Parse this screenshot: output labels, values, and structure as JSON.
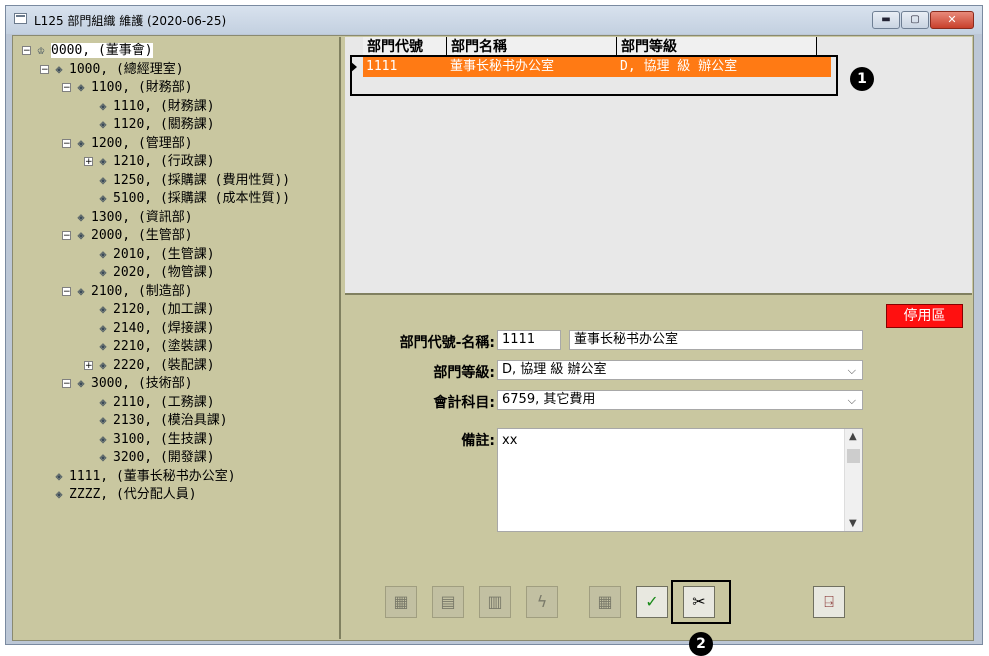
{
  "window": {
    "title": "L125 部門組織 維護 (2020-06-25)",
    "controls": {
      "minimize": "▬",
      "maximize": "▢",
      "close": "✕"
    }
  },
  "tree": {
    "nodes": [
      {
        "label": "0000, (董事會)",
        "level": 0,
        "expander": "−",
        "icon": "org-root-icon",
        "selected": true
      },
      {
        "label": "1000, (總經理室)",
        "level": 1,
        "expander": "−"
      },
      {
        "label": "1100, (財務部)",
        "level": 2,
        "expander": "−"
      },
      {
        "label": "1110, (財務課)",
        "level": 3,
        "expander": ""
      },
      {
        "label": "1120, (關務課)",
        "level": 3,
        "expander": ""
      },
      {
        "label": "1200, (管理部)",
        "level": 2,
        "expander": "−"
      },
      {
        "label": "1210, (行政課)",
        "level": 3,
        "expander": "+"
      },
      {
        "label": "1250, (採購課 (費用性質))",
        "level": 3,
        "expander": ""
      },
      {
        "label": "5100, (採購課 (成本性質))",
        "level": 3,
        "expander": ""
      },
      {
        "label": "1300, (資訊部)",
        "level": 2,
        "expander": ""
      },
      {
        "label": "2000, (生管部)",
        "level": 2,
        "expander": "−"
      },
      {
        "label": "2010, (生管課)",
        "level": 3,
        "expander": ""
      },
      {
        "label": "2020, (物管課)",
        "level": 3,
        "expander": ""
      },
      {
        "label": "2100, (制造部)",
        "level": 2,
        "expander": "−"
      },
      {
        "label": "2120, (加工課)",
        "level": 3,
        "expander": ""
      },
      {
        "label": "2140, (焊接課)",
        "level": 3,
        "expander": ""
      },
      {
        "label": "2210, (塗裝課)",
        "level": 3,
        "expander": ""
      },
      {
        "label": "2220, (裝配課)",
        "level": 3,
        "expander": "+"
      },
      {
        "label": "3000, (技術部)",
        "level": 2,
        "expander": "−"
      },
      {
        "label": "2110, (工務課)",
        "level": 3,
        "expander": ""
      },
      {
        "label": "2130, (模治具課)",
        "level": 3,
        "expander": ""
      },
      {
        "label": "3100, (生技課)",
        "level": 3,
        "expander": ""
      },
      {
        "label": "3200, (開發課)",
        "level": 3,
        "expander": ""
      },
      {
        "label": "1111, (董事长秘书办公室)",
        "level": 1,
        "expander": ""
      },
      {
        "label": "ZZZZ, (代分配人員)",
        "level": 1,
        "expander": ""
      }
    ]
  },
  "grid": {
    "columns": [
      "部門代號",
      "部門名稱",
      "部門等級"
    ],
    "rows": [
      {
        "code": "1111",
        "name": "董事长秘书办公室",
        "level": "D, 協理 級 辦公室"
      }
    ]
  },
  "form": {
    "disabled_area_label": "停用區",
    "code_name_label": "部門代號-名稱:",
    "code": "1111",
    "name": "董事长秘书办公室",
    "level_label": "部門等級:",
    "level_value": "D, 協理 級 辦公室",
    "account_label": "會計科目:",
    "account_value": "6759, 其它費用",
    "remark_label": "備註:",
    "remark_value": "xx"
  },
  "toolbar": {
    "buttons": [
      {
        "name": "add-record-button",
        "icon": "add-record-icon",
        "glyph": "▦",
        "active": false
      },
      {
        "name": "edit-record-button",
        "icon": "edit-record-icon",
        "glyph": "▤",
        "active": false
      },
      {
        "name": "delete-record-button",
        "icon": "delete-record-icon",
        "glyph": "▥",
        "active": false
      },
      {
        "name": "refresh-button",
        "icon": "lightning-icon",
        "glyph": "ϟ",
        "active": false
      },
      {
        "name": "query-button",
        "icon": "query-icon",
        "glyph": "▦",
        "active": false
      },
      {
        "name": "confirm-button",
        "icon": "checkmark-icon",
        "glyph": "✓",
        "active": true
      },
      {
        "name": "cut-button",
        "icon": "scissors-icon",
        "glyph": "✂",
        "active": true
      },
      {
        "name": "exit-button",
        "icon": "exit-door-icon",
        "glyph": "⍈",
        "active": true
      }
    ]
  },
  "annotations": {
    "badge1": "1",
    "badge2": "2"
  },
  "colors": {
    "selected_row": "#ff7a14",
    "disabled_badge": "#ff1010",
    "panel": "#c9c7a0"
  }
}
